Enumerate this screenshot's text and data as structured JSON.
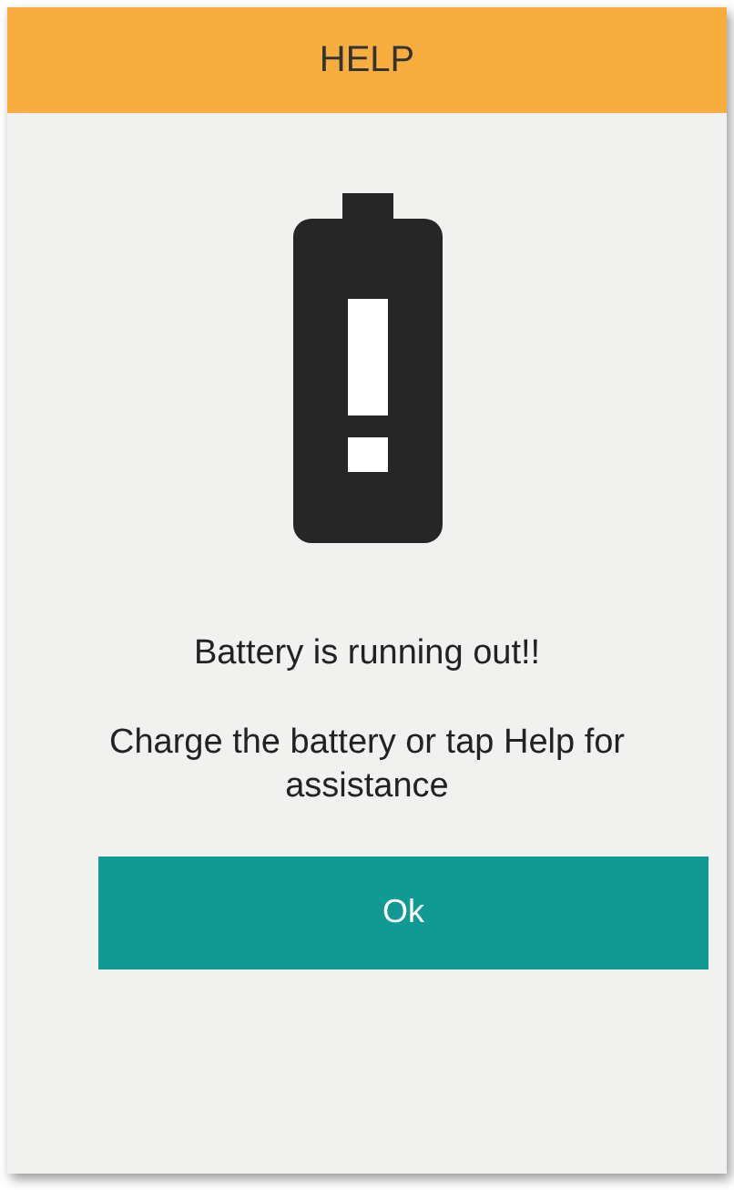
{
  "header": {
    "title": "HELP"
  },
  "message": {
    "headline": "Battery is running out!!",
    "body": "Charge the battery or tap Help for assistance"
  },
  "buttons": [
    {
      "label": "Ok"
    }
  ]
}
